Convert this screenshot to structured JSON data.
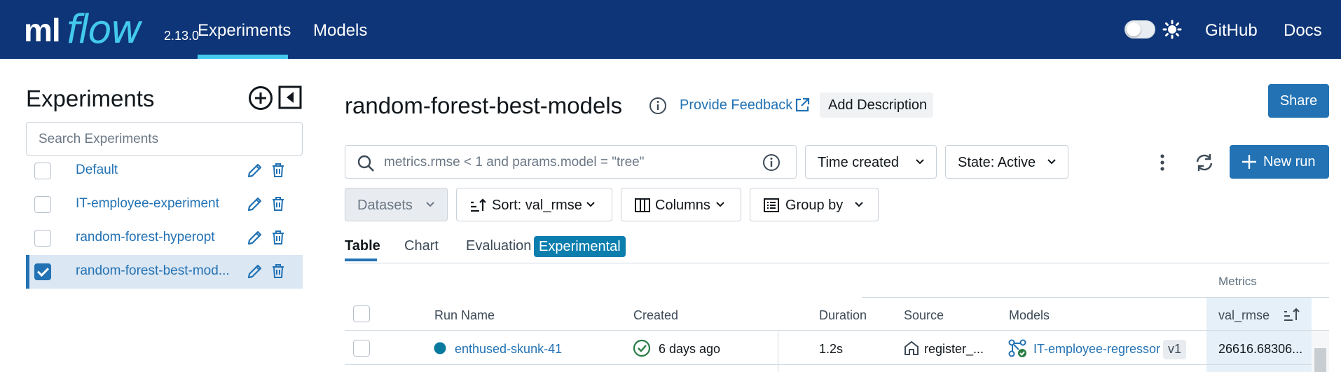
{
  "header": {
    "logo_ml": "ml",
    "logo_flow": "flow",
    "version": "2.13.0",
    "nav": [
      "Experiments",
      "Models"
    ],
    "active_nav": "Experiments",
    "links": [
      "GitHub",
      "Docs"
    ],
    "brand_color": "#0e3577",
    "accent_color": "#43c9ed"
  },
  "sidebar": {
    "title": "Experiments",
    "search_placeholder": "Search Experiments",
    "experiments": [
      {
        "name": "Default",
        "checked": false
      },
      {
        "name": "IT-employee-experiment",
        "checked": false
      },
      {
        "name": "random-forest-hyperopt",
        "checked": false
      },
      {
        "name": "random-forest-best-mod...",
        "checked": true
      }
    ]
  },
  "main": {
    "title": "random-forest-best-models",
    "feedback_label": "Provide Feedback",
    "add_description_label": "Add Description",
    "share_label": "Share",
    "filter_placeholder": "metrics.rmse < 1 and params.model = \"tree\"",
    "time_created_label": "Time created",
    "state_label": "State: Active",
    "new_run_label": "New run",
    "datasets_label": "Datasets",
    "sort_label": "Sort: val_rmse",
    "columns_label": "Columns",
    "group_by_label": "Group by",
    "view_tabs": [
      "Table",
      "Chart",
      "Evaluation"
    ],
    "active_view_tab": "Table",
    "experimental_badge": "Experimental"
  },
  "table": {
    "group_header": "Metrics",
    "columns": [
      "Run Name",
      "Created",
      "Duration",
      "Source",
      "Models",
      "val_rmse"
    ],
    "rows": [
      {
        "run_name": "enthused-skunk-41",
        "created": "6 days ago",
        "duration": "1.2s",
        "source": "register_...",
        "model": "IT-employee-regressor",
        "model_version": "v1",
        "val_rmse": "26616.68306..."
      }
    ]
  },
  "colors": {
    "primary": "#2272b4",
    "success": "#277c43",
    "run_dot": "#077a9d"
  }
}
